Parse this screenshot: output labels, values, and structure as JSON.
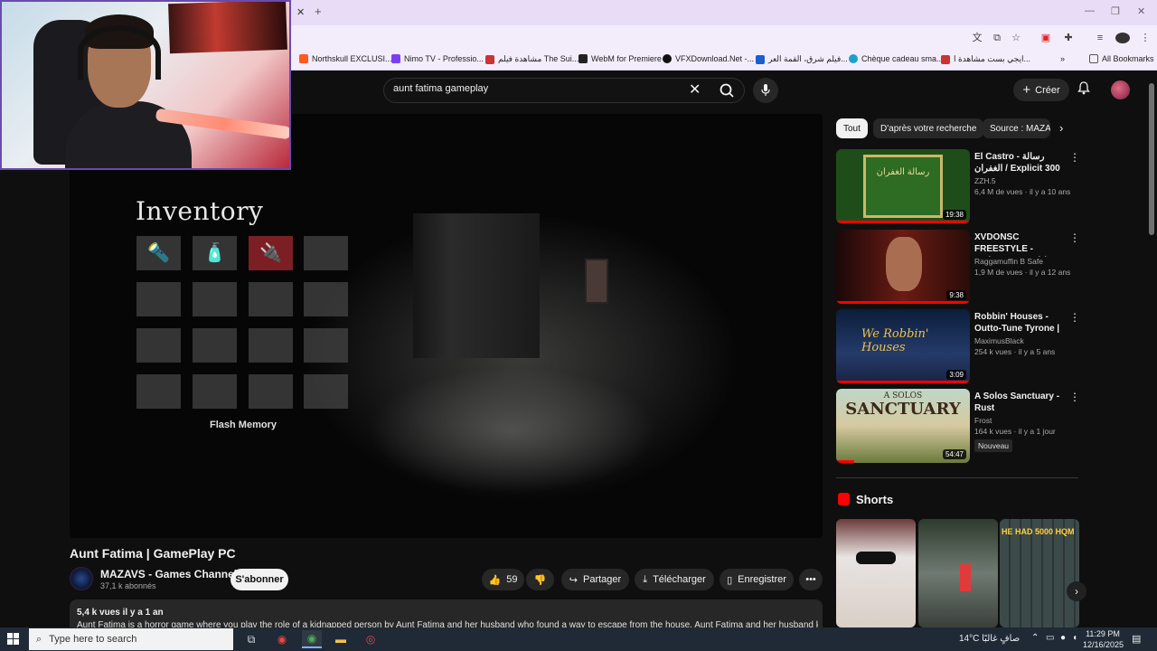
{
  "browser": {
    "bookmarks": [
      {
        "label": "Northskull EXCLUSI...",
        "color": "#ff5a1f"
      },
      {
        "label": "Nimo TV - Professio...",
        "color": "#7b3ff2"
      },
      {
        "label": "مشاهدة فيلم The Sui...",
        "color": "#c33"
      },
      {
        "label": "WebM for Premiere",
        "color": "#222"
      },
      {
        "label": "VFXDownload.Net -...",
        "color": "#111"
      },
      {
        "label": "فيلم شرق، القمة العر...",
        "color": "#1a5fd0"
      },
      {
        "label": "Chèque cadeau sma...",
        "color": "#1aa3c9"
      },
      {
        "label": "ايجي بست مشاهدة ا...",
        "color": "#c33"
      }
    ],
    "all_bookmarks": "All Bookmarks"
  },
  "header": {
    "search_query": "aunt fatima gameplay",
    "create_label": "Créer"
  },
  "video": {
    "inventory_title": "Inventory",
    "selected_item": "Flash Memory",
    "title": "Aunt Fatima | GamePlay PC",
    "channel": "MAZAVS - Games Channel",
    "subscribers": "37,1 k abonnés",
    "subscribe_label": "S'abonner",
    "likes": "59",
    "share_label": "Partager",
    "download_label": "Télécharger",
    "save_label": "Enregistrer",
    "desc_meta": "5,4 k vues  il y a 1 an",
    "desc_text": "Aunt Fatima is a horror game where you play the role of a kidnapped person by Aunt Fatima and her husband who found a way to escape from the house. Aunt Fatima and her husband kidnap"
  },
  "sidebar": {
    "chips": [
      "Tout",
      "D'après votre recherche",
      "Source : MAZAVS"
    ],
    "recommendations": [
      {
        "title": "El Castro - رسالة الغفران / Explicit 300 Bars",
        "channel": "ZZH.5",
        "meta": "6,4 M de vues · il y a 10 ans",
        "duration": "19:38",
        "badge": ""
      },
      {
        "title": "XVDONSC FREESTYLE - Emino, SC papi (ta3 ...",
        "channel": "Raggamuffin B Safe",
        "meta": "1,9 M de vues · il y a 12 ans",
        "duration": "9:38",
        "badge": ""
      },
      {
        "title": "Robbin' Houses - Outto-Tune Tyrone | ...",
        "channel": "MaximusBlack",
        "meta": "254 k vues · il y a 5 ans",
        "duration": "3:09",
        "badge": ""
      },
      {
        "title": "A Solos Sanctuary - Rust",
        "channel": "Frost",
        "meta": "164 k vues · il y a 1 jour",
        "duration": "54:47",
        "badge": "Nouveau"
      }
    ],
    "shorts_title": "Shorts"
  },
  "thumb_text": {
    "t1": "رسالة الغفران",
    "t3": "We Robbin' Houses",
    "t4a": "A SOLOS",
    "t4b": "SANCTUARY",
    "s3": "HE HAD 5000 HQM"
  },
  "taskbar": {
    "search_placeholder": "Type here to search",
    "tray": "14°C  صافٍ غالبًا",
    "time": "11:29 PM",
    "date": "12/16/2025"
  }
}
